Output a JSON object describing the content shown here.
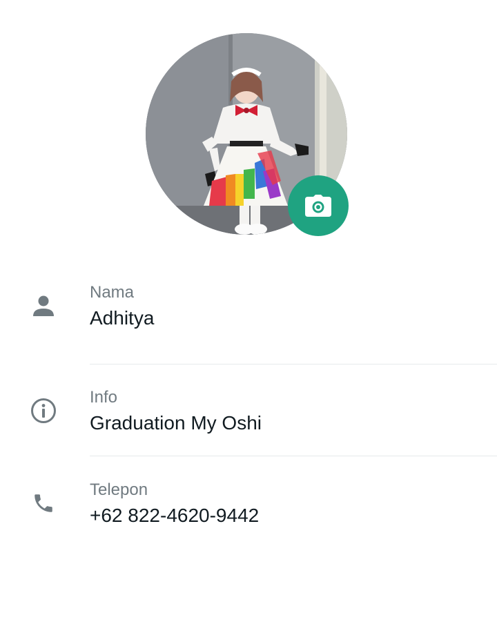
{
  "profile": {
    "photo_icon": "profile-photo",
    "camera_icon": "camera-icon",
    "accent_color": "#1fa381"
  },
  "fields": [
    {
      "icon": "person-icon",
      "label": "Nama",
      "value": "Adhitya"
    },
    {
      "icon": "info-icon",
      "label": "Info",
      "value": "Graduation My Oshi"
    },
    {
      "icon": "phone-icon",
      "label": "Telepon",
      "value": "+62 822-4620-9442"
    }
  ]
}
